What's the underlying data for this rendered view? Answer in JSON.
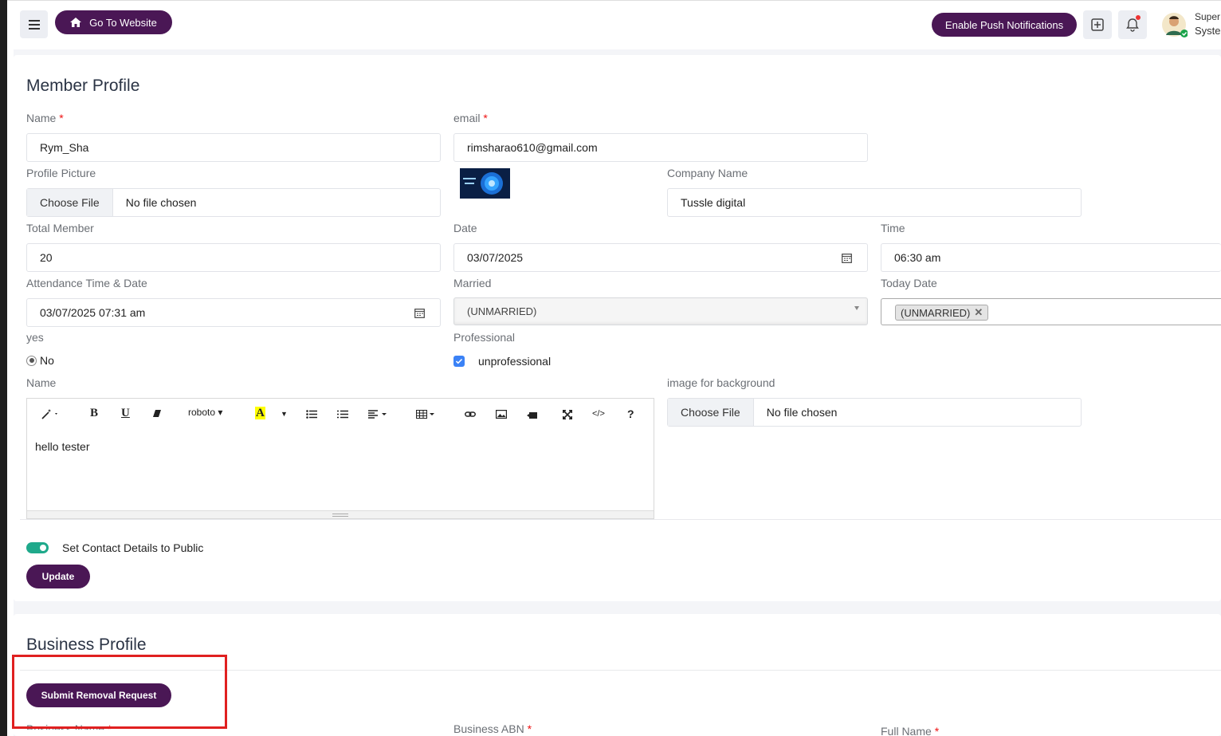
{
  "topbar": {
    "go_to_website": "Go To Website",
    "enable_push": "Enable Push Notifications",
    "user_name": "Super A",
    "user_role": "Syster"
  },
  "member_profile": {
    "title": "Member Profile",
    "name_label": "Name",
    "name_value": "Rym_Sha",
    "email_label": "email",
    "email_value": "rimsharao610@gmail.com",
    "profile_picture_label": "Profile Picture",
    "choose_file": "Choose File",
    "no_file": "No file chosen",
    "company_label": "Company Name",
    "company_value": "Tussle digital",
    "total_member_label": "Total Member",
    "total_member_value": "20",
    "date_label": "Date",
    "date_value": "03/07/2025",
    "time_label": "Time",
    "time_value": "06:30  am",
    "attendance_label": "Attendance Time & Date",
    "attendance_value": "03/07/2025 07:31  am",
    "married_label": "Married",
    "married_value": "(UNMARRIED)",
    "today_date_label": "Today Date",
    "today_date_tag": "(UNMARRIED)",
    "yes_label": "yes",
    "radio_no": "No",
    "professional_label": "Professional",
    "checkbox_label": "unprofessional",
    "editor_label": "Name",
    "editor_font": "roboto",
    "editor_content": "hello tester",
    "bg_image_label": "image for background",
    "contact_public_label": "Set Contact Details to Public",
    "update_button": "Update"
  },
  "business_profile": {
    "title": "Business Profile",
    "submit_removal": "Submit Removal Request",
    "business_name_label": "Business Name",
    "business_abn_label": "Business ABN",
    "full_name_label": "Full Name"
  },
  "colors": {
    "brand": "#4a1755",
    "toggle": "#1fa98b",
    "highlight": "#e02020"
  }
}
